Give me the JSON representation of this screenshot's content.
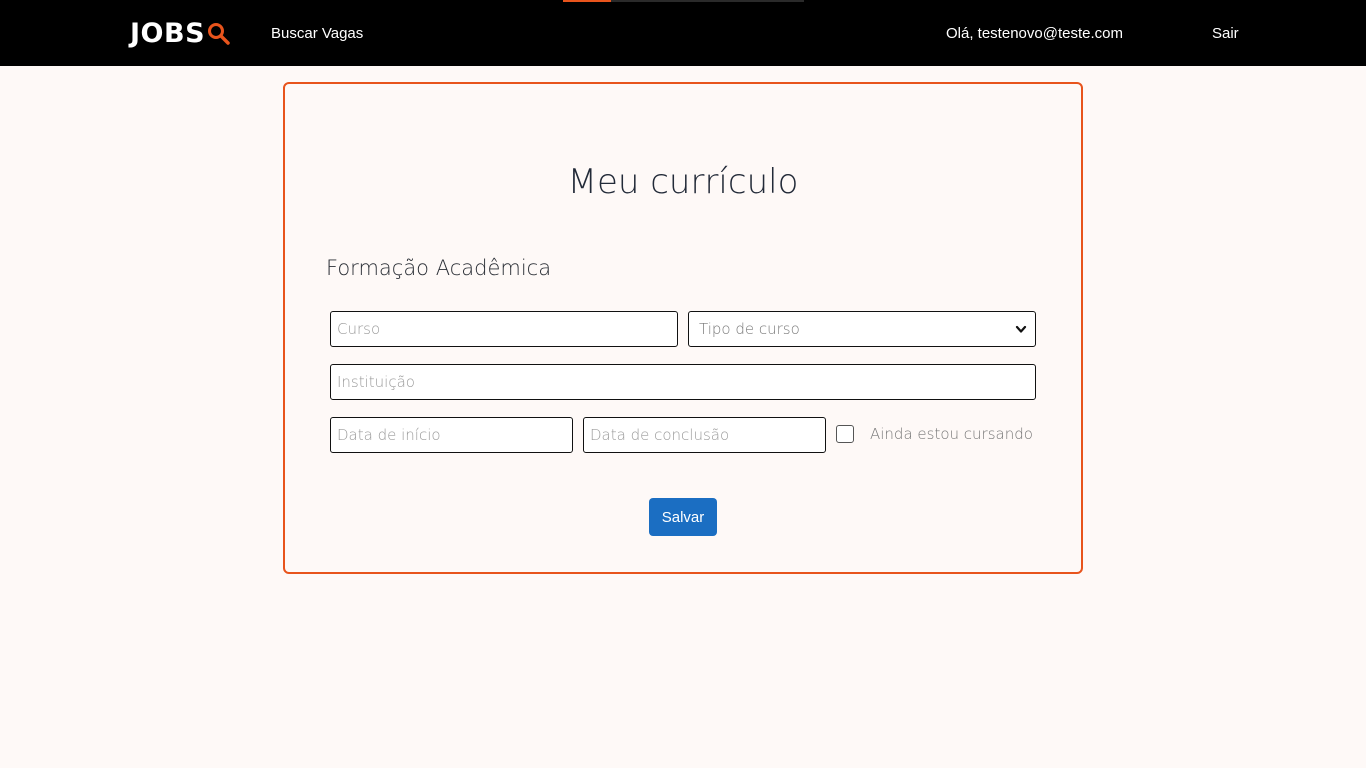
{
  "navbar": {
    "brand": "JOBS",
    "brand_icon": "magnifier-icon",
    "search_link": "Buscar Vagas",
    "greeting": "Olá, testenovo@teste.com",
    "logout": "Sair",
    "progress": 0.2,
    "colors": {
      "background": "#000000",
      "accent": "#e8541c"
    }
  },
  "form": {
    "title": "Meu currículo",
    "section_title": "Formação Acadêmica",
    "course_placeholder": "Curso",
    "course_type_selected": "Tipo de curso",
    "institution_placeholder": "Instituição",
    "start_date_placeholder": "Data de início",
    "end_date_placeholder": "Data de conclusão",
    "still_studying_label": "Ainda estou cursando",
    "still_studying_checked": false,
    "save_button": "Salvar"
  },
  "colors": {
    "page_background": "#fef9f7",
    "card_border": "#e8541c",
    "primary_button": "#1b6ec2"
  }
}
